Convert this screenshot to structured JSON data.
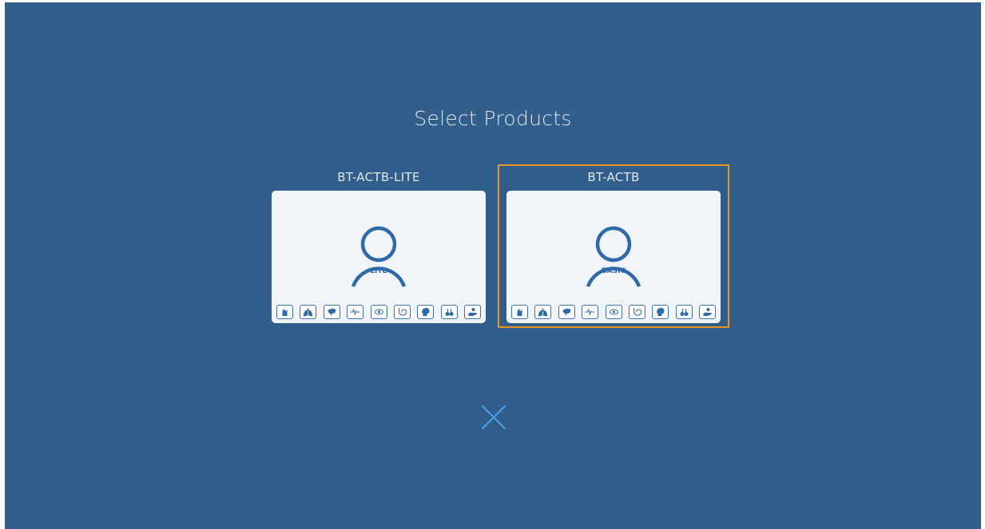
{
  "page": {
    "title": "Select Products"
  },
  "products": [
    {
      "name": "BT-ACTB-LITE",
      "tier": "LITE",
      "selected": false,
      "features": [
        "hand-icon",
        "lungs-icon",
        "liver-icon",
        "heartbeat-icon",
        "eye-icon",
        "stomach-icon",
        "head-icon",
        "kidney-icon",
        "hand-holding-icon"
      ]
    },
    {
      "name": "BT-ACTB",
      "tier": "BASIC",
      "selected": true,
      "features": [
        "hand-icon",
        "lungs-icon",
        "liver-icon",
        "heartbeat-icon",
        "eye-icon",
        "stomach-icon",
        "head-icon",
        "kidney-icon",
        "hand-holding-icon"
      ]
    }
  ],
  "close": {
    "icon": "close-icon"
  },
  "colors": {
    "background": "#315e8a",
    "card": "#f1f4f8",
    "accent": "#2f6aa8",
    "selection": "#e8951e",
    "close": "#4a9be6"
  }
}
